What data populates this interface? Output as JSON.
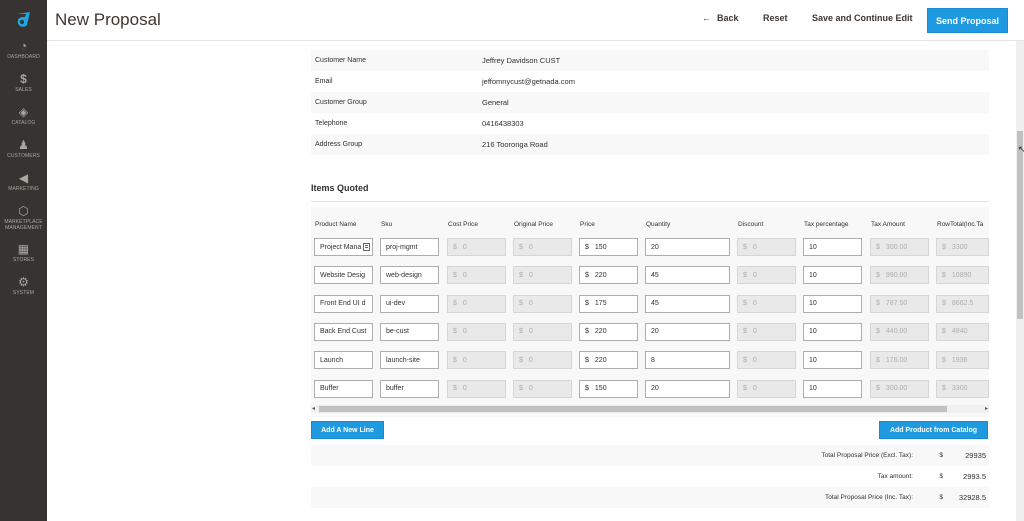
{
  "nav": {
    "items": [
      {
        "label": "DASHBOARD",
        "icon": "dashboard-icon"
      },
      {
        "label": "SALES",
        "icon": "dollar-icon"
      },
      {
        "label": "CATALOG",
        "icon": "cube-icon"
      },
      {
        "label": "CUSTOMERS",
        "icon": "person-icon"
      },
      {
        "label": "MARKETING",
        "icon": "megaphone-icon"
      },
      {
        "label": "MARKETPLACE MANAGEMENT",
        "icon": "hexagon-icon"
      },
      {
        "label": "STORES",
        "icon": "store-icon"
      },
      {
        "label": "SYSTEM",
        "icon": "gear-icon"
      }
    ]
  },
  "header": {
    "title": "New Proposal",
    "back_label": "Back",
    "reset_label": "Reset",
    "save_label": "Save and Continue Edit",
    "send_label": "Send Proposal"
  },
  "customer": {
    "rows": [
      {
        "label": "Customer Name",
        "value": "Jeffrey Davidson CUST"
      },
      {
        "label": "Email",
        "value": "jeffomnycust@getnada.com"
      },
      {
        "label": "Customer Group",
        "value": "General"
      },
      {
        "label": "Telephone",
        "value": "0416438303"
      },
      {
        "label": "Address Group",
        "value": "216 Tooronga Road"
      }
    ]
  },
  "items": {
    "title": "Items Quoted",
    "columns": [
      "Product Name",
      "Sku",
      "Cost Price",
      "Original Price",
      "Price",
      "Quantity",
      "Discount",
      "Tax percentage",
      "Tax Amount",
      "RowTotal(Inc.Ta"
    ],
    "currency": "$",
    "rows": [
      {
        "name": "Project Mana",
        "sku": "proj-mgmt",
        "cost": "0",
        "original": "0",
        "price": "150",
        "qty": "20",
        "discount": "0",
        "tax_pct": "10",
        "tax_amt": "300.00",
        "row_total": "3300"
      },
      {
        "name": "Website Desig",
        "sku": "web-design",
        "cost": "0",
        "original": "0",
        "price": "220",
        "qty": "45",
        "discount": "0",
        "tax_pct": "10",
        "tax_amt": "990.00",
        "row_total": "10890"
      },
      {
        "name": "Front End UI d",
        "sku": "ui-dev",
        "cost": "0",
        "original": "0",
        "price": "175",
        "qty": "45",
        "discount": "0",
        "tax_pct": "10",
        "tax_amt": "787.50",
        "row_total": "8662.5"
      },
      {
        "name": "Back End Cust",
        "sku": "be-cust",
        "cost": "0",
        "original": "0",
        "price": "220",
        "qty": "20",
        "discount": "0",
        "tax_pct": "10",
        "tax_amt": "440.00",
        "row_total": "4840"
      },
      {
        "name": "Launch",
        "sku": "launch-site",
        "cost": "0",
        "original": "0",
        "price": "220",
        "qty": "8",
        "discount": "0",
        "tax_pct": "10",
        "tax_amt": "176.00",
        "row_total": "1936"
      },
      {
        "name": "Buffer",
        "sku": "buffer",
        "cost": "0",
        "original": "0",
        "price": "150",
        "qty": "20",
        "discount": "0",
        "tax_pct": "10",
        "tax_amt": "300.00",
        "row_total": "3300"
      }
    ],
    "add_line_label": "Add A New Line",
    "add_catalog_label": "Add Product from Catalog"
  },
  "totals": {
    "rows": [
      {
        "label": "Total Proposal Price (Excl. Tax):",
        "currency": "$",
        "value": "29935"
      },
      {
        "label": "Tax amount:",
        "currency": "$",
        "value": "2993.5"
      },
      {
        "label": "Total Proposal Price (Inc. Tax):",
        "currency": "$",
        "value": "32928.5"
      }
    ]
  },
  "colors": {
    "accent": "#1f9ae0",
    "nav_bg": "#373330",
    "logo": "#1fa6e0"
  }
}
